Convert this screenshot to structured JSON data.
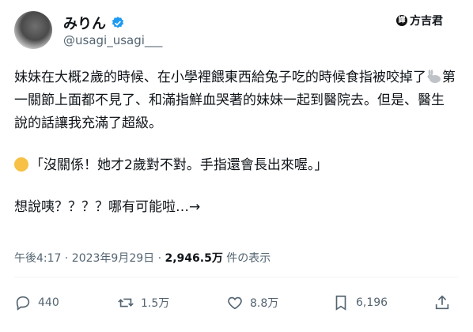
{
  "author": {
    "name": "みりん",
    "handle": "@usagi_usagi___"
  },
  "watermark": {
    "dot": "譯",
    "suffix": "方吉君"
  },
  "post": {
    "p1_a": "妹妹在大概2歲的時候、在小學裡餵東西給兔子吃的時候食指被咬掉了",
    "p1_b": "第一關節上面都不見了、和滿指鮮血哭著的妹妹一起到醫院去。但是、醫生說的話讓我充滿了超級。",
    "quote": "「沒關係！她才2歲對不對。手指還會長出來喔。」",
    "p3": "想說咦？？？？哪有可能啦…→"
  },
  "meta": {
    "time": "午後4:17 · 2023年9月29日 ·",
    "views_count": "2,946.5万",
    "views_label": "件の表示"
  },
  "actions": {
    "replies": "440",
    "reposts": "1.5万",
    "likes": "8.8万",
    "bookmarks": "6,196"
  },
  "colors": {
    "text": "#0f1419",
    "secondary": "#536471",
    "verified": "#1d9bf0"
  }
}
